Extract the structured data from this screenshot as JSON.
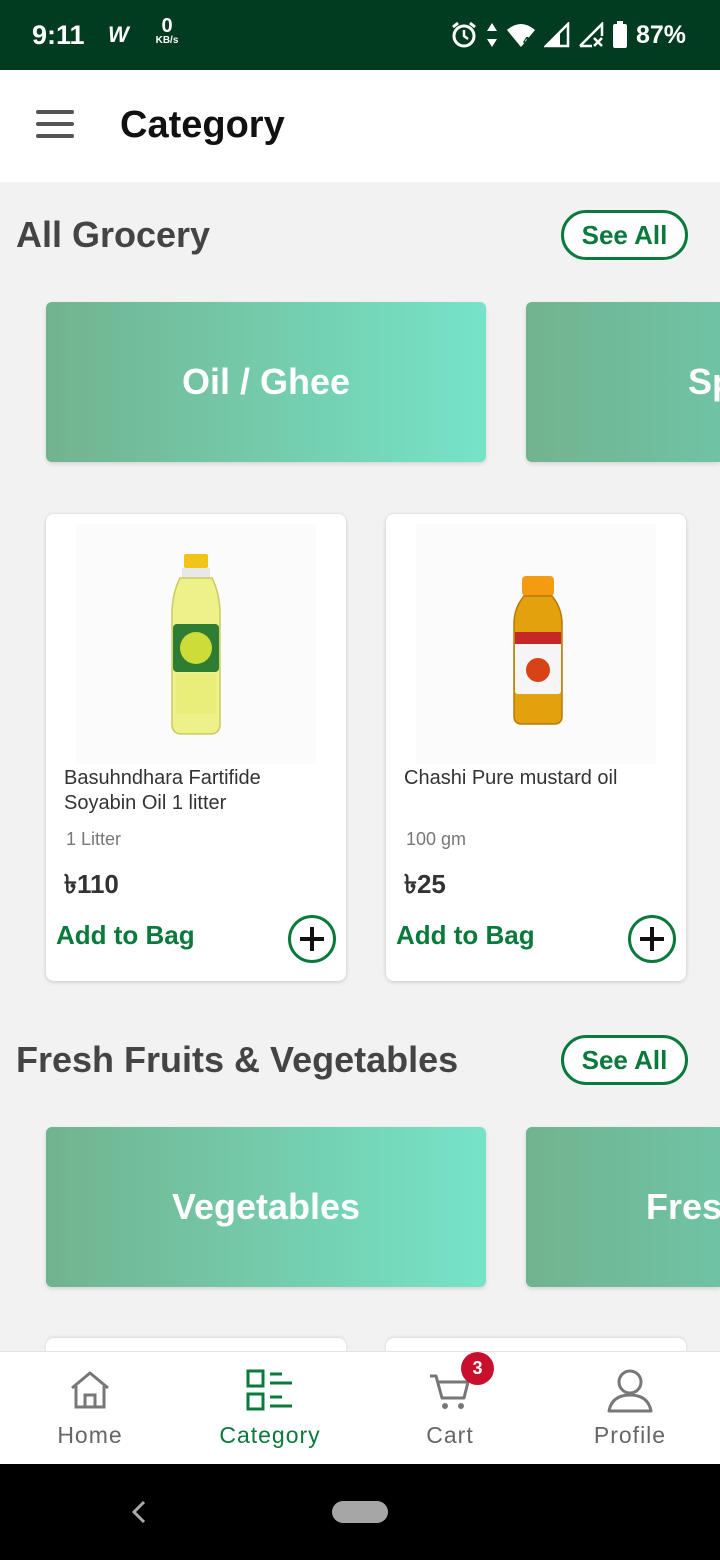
{
  "status_bar": {
    "time": "9:11",
    "wifi_calling": "W",
    "net_speed_value": "0",
    "net_speed_unit": "KB/s",
    "battery_percent": "87%",
    "icons": [
      "wifi-calling-icon",
      "alarm-icon",
      "data-arrows-icon",
      "wifi-icon",
      "signal-icon",
      "signal-no-service-icon",
      "battery-icon"
    ]
  },
  "app_bar": {
    "title": "Category",
    "menu_icon": "hamburger-menu-icon"
  },
  "sections": [
    {
      "title": "All Grocery",
      "see_all_label": "See All",
      "banners": [
        {
          "label": "Oil / Ghee"
        },
        {
          "label": "Sp"
        }
      ],
      "products": [
        {
          "name": "Basuhndhara Fartifide Soyabin Oil 1 litter",
          "quantity": "1 Litter",
          "price": "৳110",
          "add_label": "Add to Bag",
          "image": "soybean-oil-bottle-image"
        },
        {
          "name": "Chashi Pure mustard oil",
          "quantity": "100 gm",
          "price": "৳25",
          "add_label": "Add to Bag",
          "image": "mustard-oil-bottle-image"
        }
      ]
    },
    {
      "title": "Fresh Fruits & Vegetables",
      "see_all_label": "See All",
      "banners": [
        {
          "label": "Vegetables"
        },
        {
          "label": "Fres"
        }
      ]
    }
  ],
  "bottom_nav": {
    "items": [
      {
        "label": "Home",
        "icon": "home-icon"
      },
      {
        "label": "Category",
        "icon": "category-icon",
        "active": true
      },
      {
        "label": "Cart",
        "icon": "cart-icon"
      },
      {
        "label": "Profile",
        "icon": "profile-icon"
      }
    ],
    "cart_badge": "3"
  },
  "colors": {
    "status_bar": "#013c20",
    "accent_green": "#0a7a3c",
    "banner_start": "#72b38f",
    "banner_end": "#76e3c8",
    "badge_red": "#c8102e",
    "background": "#f2f2f2"
  }
}
